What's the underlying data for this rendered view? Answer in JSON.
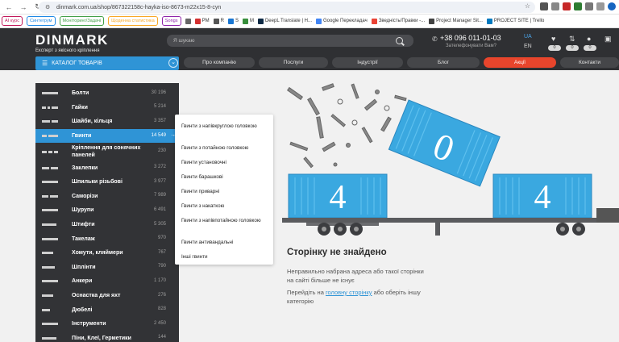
{
  "browser": {
    "url": "dinmark.com.ua/shop/867322158c-hayka-iso-8673-m22x15-8-cyn",
    "bookmarks_chips": [
      {
        "label": "AI курс",
        "color": "#c2185b"
      },
      {
        "label": "Синтегрум",
        "color": "#1e88e5"
      },
      {
        "label": "Моніторинг/Задачі",
        "color": "#43a047"
      },
      {
        "label": "Щоденна статистика",
        "color": "#f9a825"
      },
      {
        "label": "Songs",
        "color": "#8e24aa"
      }
    ],
    "bookmarks": [
      {
        "label": "PM",
        "icon": "pm-icon",
        "color": "#d32f2f"
      },
      {
        "label": "R",
        "icon": "r-icon",
        "color": "#555555"
      },
      {
        "label": "S",
        "icon": "s-icon",
        "color": "#1976d2"
      },
      {
        "label": "M",
        "icon": "m-icon",
        "color": "#388e3c"
      },
      {
        "label": "DeepL Translate | H...",
        "icon": "deepl-icon",
        "color": "#0f2b46"
      },
      {
        "label": "Google Перекладач",
        "icon": "google-translate-icon",
        "color": "#4285f4"
      },
      {
        "label": "Зведність/Правки -...",
        "icon": "google-icon",
        "color": "#ea4335"
      },
      {
        "label": "Project Manager Sit...",
        "icon": "project-manager-icon",
        "color": "#424242"
      },
      {
        "label": "PROJECT SITE | Trello",
        "icon": "trello-icon",
        "color": "#0079bf"
      }
    ]
  },
  "header": {
    "logo": "DINMARK",
    "logo_sub": "Експерт з якісного кріплення",
    "search_placeholder": "Я шукаю",
    "phone": "+38 096 011-01-03",
    "callback": "Зателефонувати Вам?",
    "lang_active": "UA",
    "lang_other": "EN",
    "badges": [
      "0",
      "0",
      "0"
    ]
  },
  "nav": {
    "catalog_label": "КАТАЛОГ ТОВАРІВ",
    "items": [
      "Про компанію",
      "Послуги",
      "Індустрії",
      "Блог",
      "Акції",
      "Контакти"
    ]
  },
  "categories": [
    {
      "label": "Болти",
      "count": "30 196"
    },
    {
      "label": "Гайки",
      "count": "5 214"
    },
    {
      "label": "Шайби, кільця",
      "count": "3 357"
    },
    {
      "label": "Гвинти",
      "count": "14 549"
    },
    {
      "label": "Кріплення для сонячних панелей",
      "count": "230"
    },
    {
      "label": "Заклепки",
      "count": "3 272"
    },
    {
      "label": "Шпильки різьбові",
      "count": "3 977"
    },
    {
      "label": "Саморізи",
      "count": "7 989"
    },
    {
      "label": "Шурупи",
      "count": "6 491"
    },
    {
      "label": "Штифти",
      "count": "5 305"
    },
    {
      "label": "Такелаж",
      "count": "970"
    },
    {
      "label": "Хомути, кляймери",
      "count": "767"
    },
    {
      "label": "Шплінти",
      "count": "790"
    },
    {
      "label": "Анкери",
      "count": "1 170"
    },
    {
      "label": "Оснастка для яхт",
      "count": "276"
    },
    {
      "label": "Дюбелі",
      "count": "828"
    },
    {
      "label": "Інструменти",
      "count": "2 450"
    },
    {
      "label": "Піни, Клеї, Герметики",
      "count": "144"
    }
  ],
  "submenu": [
    "Гвинти з напівкруглою головкою",
    "Гвинти з потайною головкою",
    "Гвинти установочні",
    "Гвинти барашкові",
    "Гвинти приварні",
    "Гвинти з накаткою",
    "Гвинти з напівпотайною головкою",
    "Гвинти антивандальні",
    "Інші гвинти"
  ],
  "error": {
    "digit_left": "4",
    "digit_middle": "0",
    "digit_right": "4",
    "title": "Сторінку не знайдено",
    "desc": "Неправильно набрана адреса або такої сторінки на сайті більше не існує",
    "hint_prefix": "Перейдіть на ",
    "hint_link": "головну сторінку",
    "hint_suffix": " або оберіть іншу категорію"
  },
  "colors": {
    "header_bg": "#2f3033",
    "accent": "#2f94d6",
    "promo": "#e8452c",
    "container": "#3aa8e0"
  }
}
